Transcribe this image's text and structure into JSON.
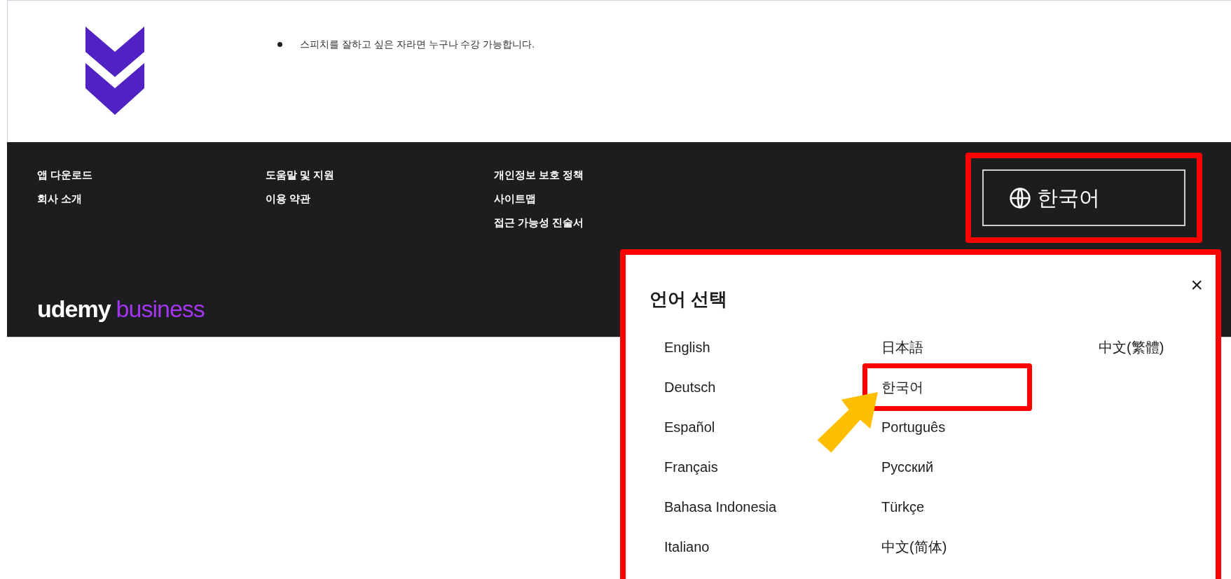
{
  "requirements": {
    "items": [
      "스피치를 잘하고 싶은 자라면 누구나 수강 가능합니다."
    ]
  },
  "footer": {
    "link_columns": [
      [
        "앱 다운로드",
        "회사 소개"
      ],
      [
        "도움말 및 지원",
        "이용 약관"
      ],
      [
        "개인정보 보호 정책",
        "사이트맵",
        "접근 가능성 진술서"
      ]
    ],
    "logo": {
      "word": "udemy",
      "suffix": "business"
    },
    "language_button": {
      "label": "한국어",
      "highlighted": true
    }
  },
  "language_dialog": {
    "title": "언어 선택",
    "close": "×",
    "highlighted": true,
    "languages": [
      [
        {
          "label": "English",
          "marked": false
        },
        {
          "label": "Deutsch",
          "marked": false
        },
        {
          "label": "Español",
          "marked": false
        },
        {
          "label": "Français",
          "marked": false
        },
        {
          "label": "Bahasa Indonesia",
          "marked": false
        },
        {
          "label": "Italiano",
          "marked": false
        }
      ],
      [
        {
          "label": "日本語",
          "marked": false
        },
        {
          "label": "한국어",
          "marked": true
        },
        {
          "label": "Português",
          "marked": false
        },
        {
          "label": "Русский",
          "marked": false
        },
        {
          "label": "Türkçe",
          "marked": false
        },
        {
          "label": "中文(简体)",
          "marked": false
        }
      ],
      [
        {
          "label": "中文(繁體)",
          "marked": false
        }
      ]
    ]
  }
}
